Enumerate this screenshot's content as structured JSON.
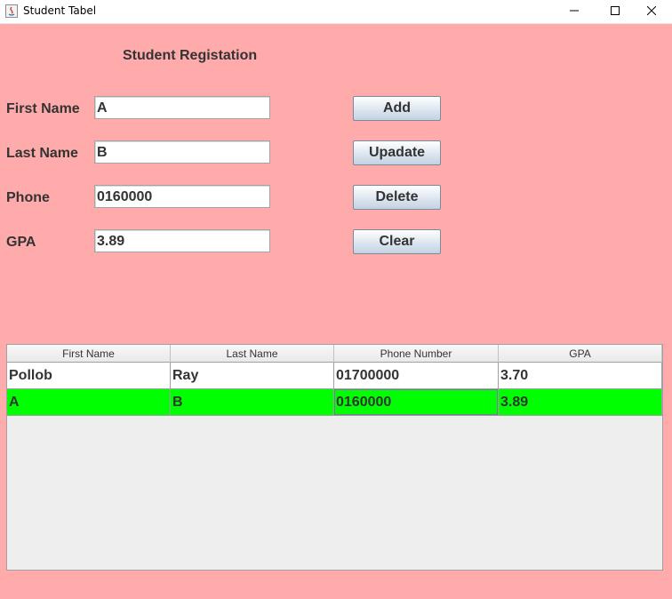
{
  "window": {
    "title": "Student Tabel",
    "controls": [
      "minimize-icon",
      "maximize-icon",
      "close-icon"
    ]
  },
  "form": {
    "heading": "Student Registation",
    "fields": [
      {
        "label": "First Name",
        "value": "A"
      },
      {
        "label": "Last Name",
        "value": "B"
      },
      {
        "label": "Phone",
        "value": "0160000"
      },
      {
        "label": "GPA",
        "value": "3.89"
      }
    ]
  },
  "buttons": {
    "add": "Add",
    "update": "Upadate",
    "delete": "Delete",
    "clear": "Clear"
  },
  "table": {
    "columns": [
      "First Name",
      "Last Name",
      "Phone Number",
      "GPA"
    ],
    "rows": [
      [
        "Pollob",
        "Ray",
        "01700000",
        "3.70"
      ],
      [
        "A",
        "B",
        "0160000",
        "3.89"
      ]
    ],
    "selected_row_color": "#00ff00"
  },
  "colors": {
    "background": "#ffabab",
    "text": "#333333"
  }
}
